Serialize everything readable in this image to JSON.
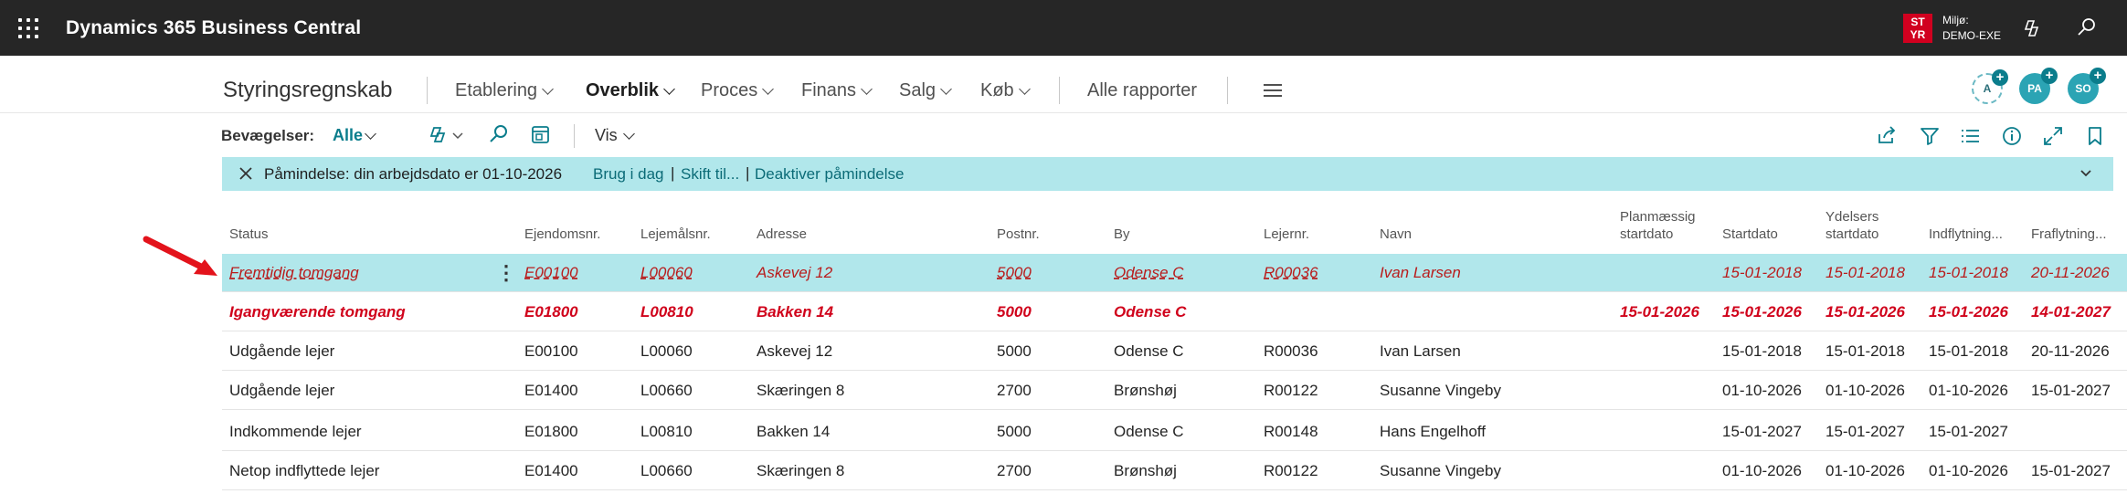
{
  "app": {
    "title": "Dynamics 365 Business Central",
    "env_badge": [
      "ST",
      "YR"
    ],
    "env_label": "Miljø:",
    "env_name": "DEMO-EXE"
  },
  "nav": {
    "title": "Styringsregnskab",
    "items": [
      {
        "label": "Etablering",
        "dropdown": true,
        "active": false
      },
      {
        "label": "Overblik",
        "dropdown": true,
        "active": true
      },
      {
        "label": "Proces",
        "dropdown": true,
        "active": false
      },
      {
        "label": "Finans",
        "dropdown": true,
        "active": false
      },
      {
        "label": "Salg",
        "dropdown": true,
        "active": false
      },
      {
        "label": "Køb",
        "dropdown": true,
        "active": false
      },
      {
        "label": "Alle rapporter",
        "dropdown": false,
        "active": false
      }
    ],
    "avatars": [
      "A",
      "PA",
      "SO"
    ],
    "avatar_plus": "+"
  },
  "actions": {
    "label": "Bevægelser:",
    "filter": "Alle",
    "vis": "Vis"
  },
  "banner": {
    "text": "Påmindelse: din arbejdsdato er 01-10-2026",
    "link1": "Brug i dag",
    "link2": "Skift til...",
    "link3": "Deaktiver påmindelse",
    "separator": "|"
  },
  "table": {
    "columns": {
      "status": "Status",
      "ejendom": "Ejendomsnr.",
      "lejemaal": "Lejemålsnr.",
      "adresse": "Adresse",
      "postnr": "Postnr.",
      "by": "By",
      "lejernr": "Lejernr.",
      "navn": "Navn",
      "planstart_1": "Planmæssig",
      "planstart_2": "startdato",
      "startdato": "Startdato",
      "ydelser_1": "Ydelsers",
      "ydelser_2": "startdato",
      "indflyt": "Indflytning...",
      "fraflyt": "Fraflytning..."
    },
    "rows": [
      {
        "status": "Fremtidig tomgang",
        "ejendom": "E00100",
        "lejemaal": "L00060",
        "adresse": "Askevej 12",
        "postnr": "5000",
        "by": "Odense C",
        "lejernr": "R00036",
        "navn": "Ivan Larsen",
        "planstart": "",
        "startdato": "15-01-2018",
        "ydelser": "15-01-2018",
        "indflyt": "15-01-2018",
        "fraflyt": "20-11-2026"
      },
      {
        "status": "Igangværende tomgang",
        "ejendom": "E01800",
        "lejemaal": "L00810",
        "adresse": "Bakken 14",
        "postnr": "5000",
        "by": "Odense C",
        "lejernr": "",
        "navn": "",
        "planstart": "15-01-2026",
        "startdato": "15-01-2026",
        "ydelser": "15-01-2026",
        "indflyt": "15-01-2026",
        "fraflyt": "14-01-2027"
      },
      {
        "status": "Udgående lejer",
        "ejendom": "E00100",
        "lejemaal": "L00060",
        "adresse": "Askevej 12",
        "postnr": "5000",
        "by": "Odense C",
        "lejernr": "R00036",
        "navn": "Ivan Larsen",
        "planstart": "",
        "startdato": "15-01-2018",
        "ydelser": "15-01-2018",
        "indflyt": "15-01-2018",
        "fraflyt": "20-11-2026"
      },
      {
        "status": "Udgående lejer",
        "ejendom": "E01400",
        "lejemaal": "L00660",
        "adresse": "Skæringen 8",
        "postnr": "2700",
        "by": "Brønshøj",
        "lejernr": "R00122",
        "navn": "Susanne Vingeby",
        "planstart": "",
        "startdato": "01-10-2026",
        "ydelser": "01-10-2026",
        "indflyt": "01-10-2026",
        "fraflyt": "15-01-2027"
      },
      {
        "status": "Indkommende lejer",
        "ejendom": "E01800",
        "lejemaal": "L00810",
        "adresse": "Bakken 14",
        "postnr": "5000",
        "by": "Odense C",
        "lejernr": "R00148",
        "navn": "Hans Engelhoff",
        "planstart": "",
        "startdato": "15-01-2027",
        "ydelser": "15-01-2027",
        "indflyt": "15-01-2027",
        "fraflyt": ""
      },
      {
        "status": "Netop indflyttede lejer",
        "ejendom": "E01400",
        "lejemaal": "L00660",
        "adresse": "Skæringen 8",
        "postnr": "2700",
        "by": "Brønshøj",
        "lejernr": "R00122",
        "navn": "Susanne Vingeby",
        "planstart": "",
        "startdato": "01-10-2026",
        "ydelser": "01-10-2026",
        "indflyt": "01-10-2026",
        "fraflyt": "15-01-2027"
      }
    ]
  },
  "colors": {
    "appbar": "#262626",
    "accent": "#0b7d8c",
    "banner": "#b1e7eb",
    "attention_red": "#d0021b",
    "arrow": "#e3131b"
  }
}
